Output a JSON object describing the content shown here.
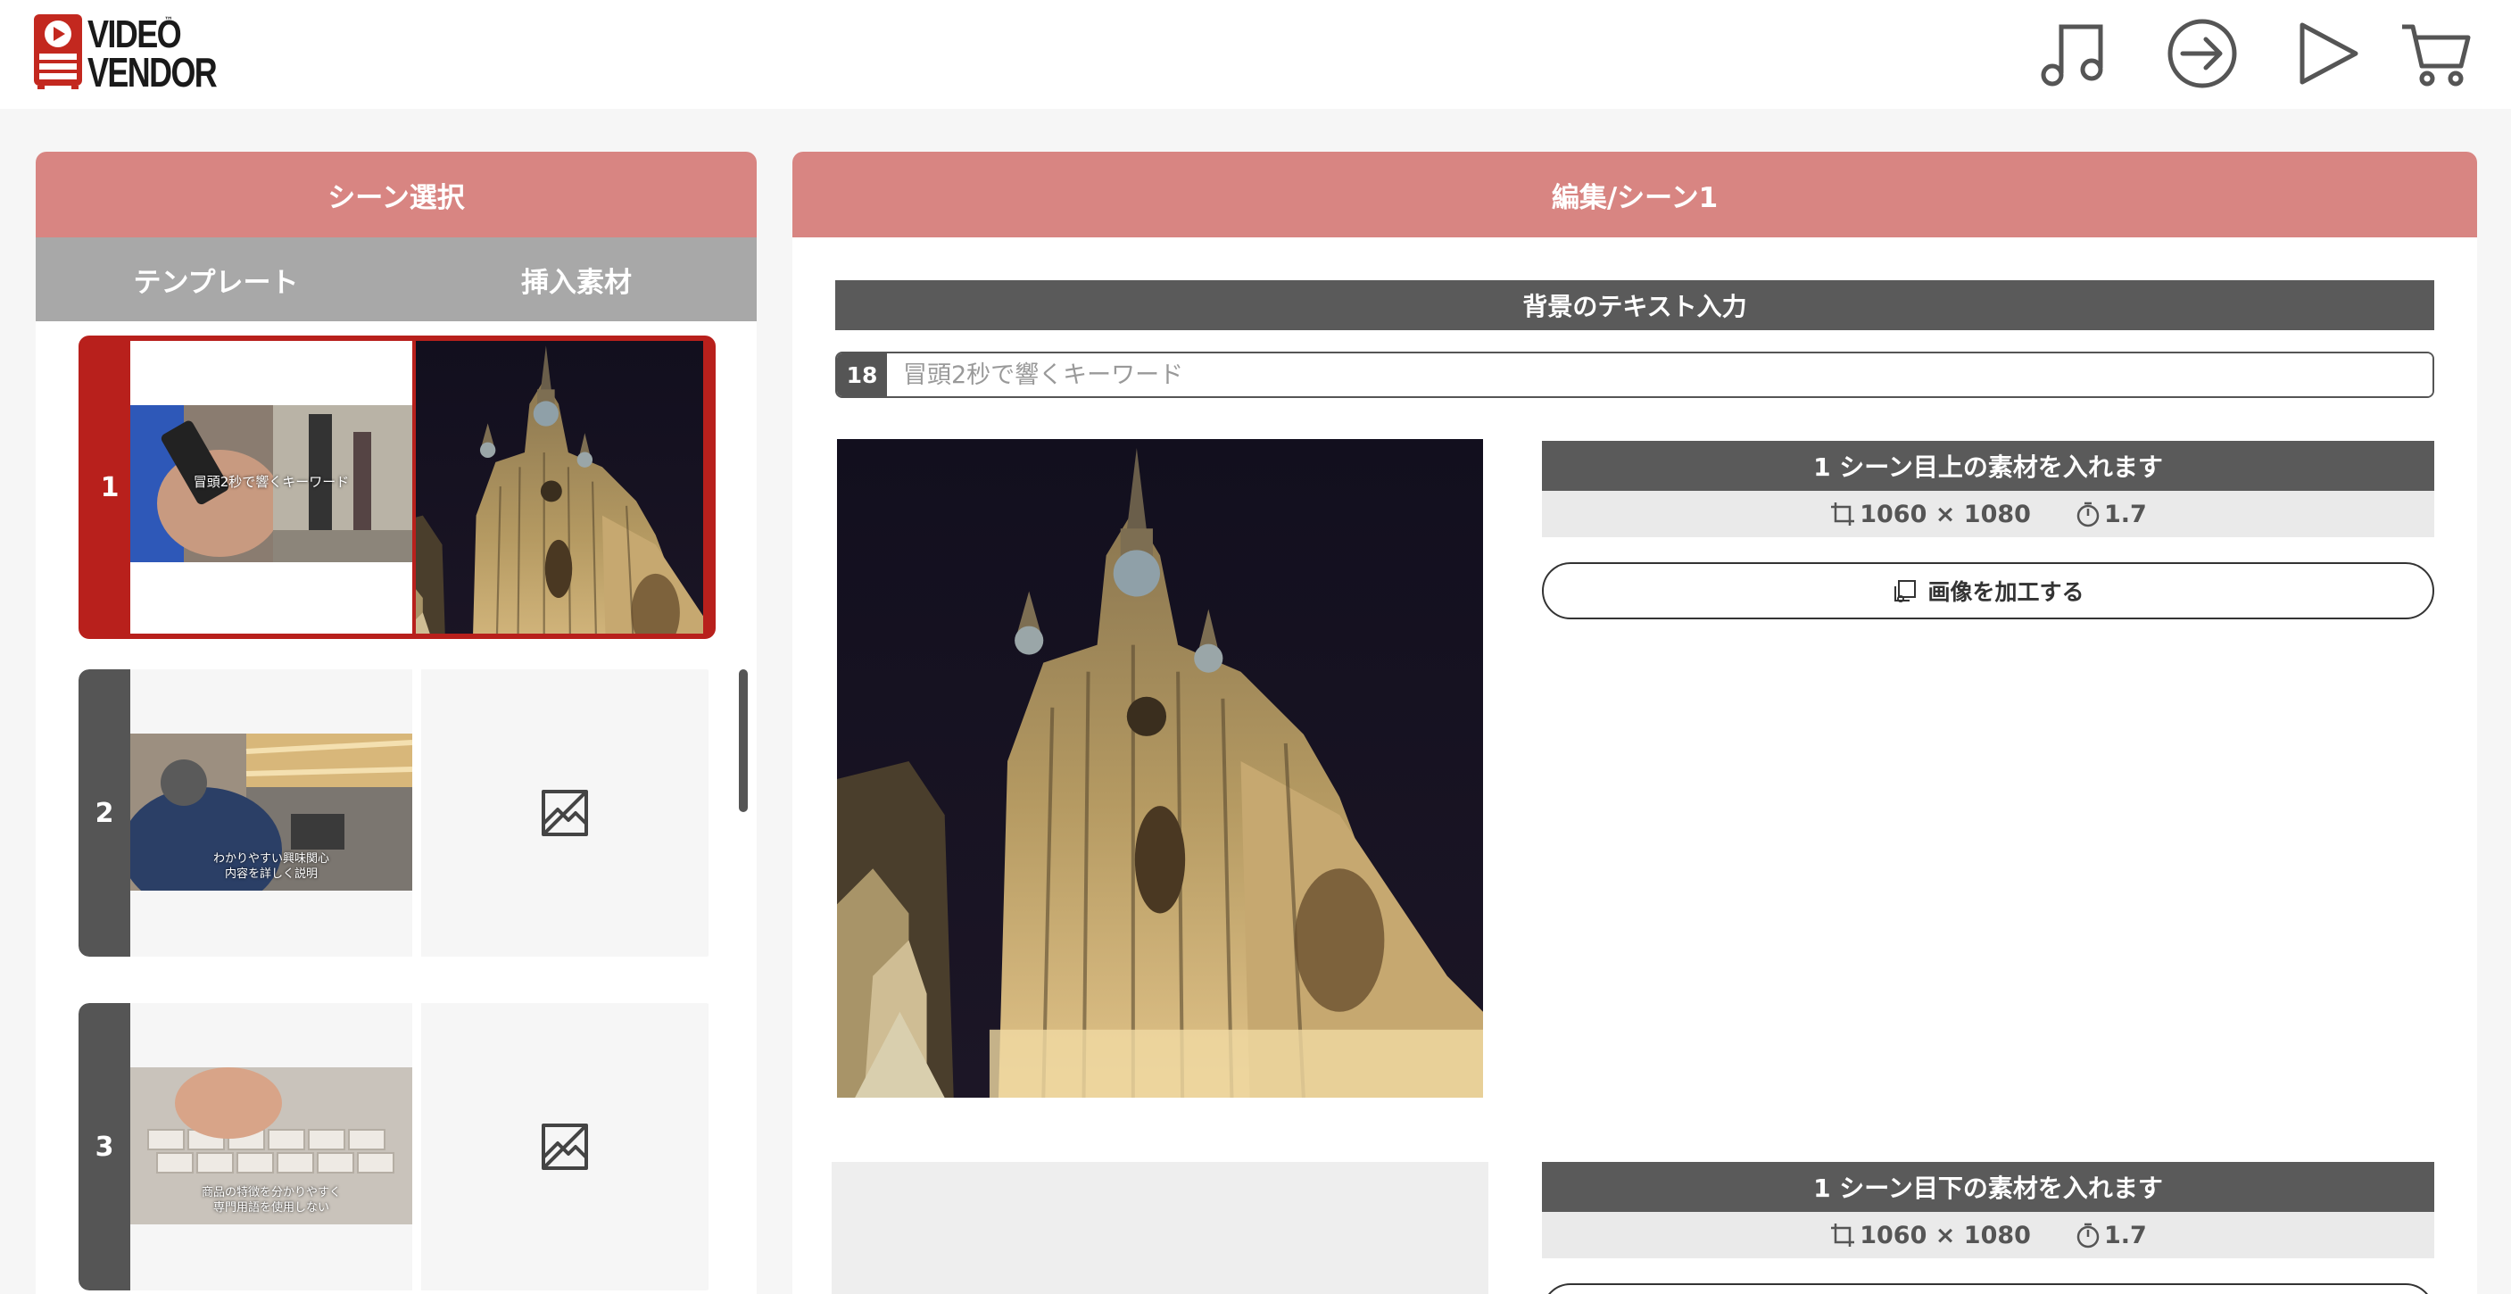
{
  "header": {
    "logo_line1": "VIDEO",
    "logo_line2": "VENDOR",
    "logo_tm": "™",
    "icons": [
      "music-note-icon",
      "arrow-circle-right-icon",
      "play-icon",
      "cart-icon"
    ]
  },
  "left_panel": {
    "title": "シーン選択",
    "tabs": [
      {
        "label": "テンプレート"
      },
      {
        "label": "挿入素材"
      }
    ],
    "scenes": [
      {
        "number": "1",
        "caption": "冒頭2秒で響くキーワード",
        "selected": true,
        "has_material": true
      },
      {
        "number": "2",
        "caption": "わかりやすい興味関心\n内容を詳しく説明",
        "selected": false,
        "has_material": false
      },
      {
        "number": "3",
        "caption": "商品の特徴を分かりやすく\n専門用語を使用しない",
        "selected": false,
        "has_material": false
      }
    ]
  },
  "right_panel": {
    "title": "編集/シーン1",
    "bg_text_section": "背景のテキスト入力",
    "char_count": "18",
    "text_placeholder": "冒頭2秒で響くキーワード",
    "materials": [
      {
        "heading": "1 シーン目上の素材を入れます",
        "resolution": "1060 × 1080",
        "duration": "1.7",
        "edit_label": "画像を加工する"
      },
      {
        "heading": "1 シーン目下の素材を入れます",
        "resolution": "1060 × 1080",
        "duration": "1.7"
      }
    ]
  },
  "colors": {
    "panel_header": "#d88582",
    "selected_scene": "#b8201c",
    "dark_bar": "#5a5a5a",
    "tab_bar": "#a8a8a8"
  }
}
